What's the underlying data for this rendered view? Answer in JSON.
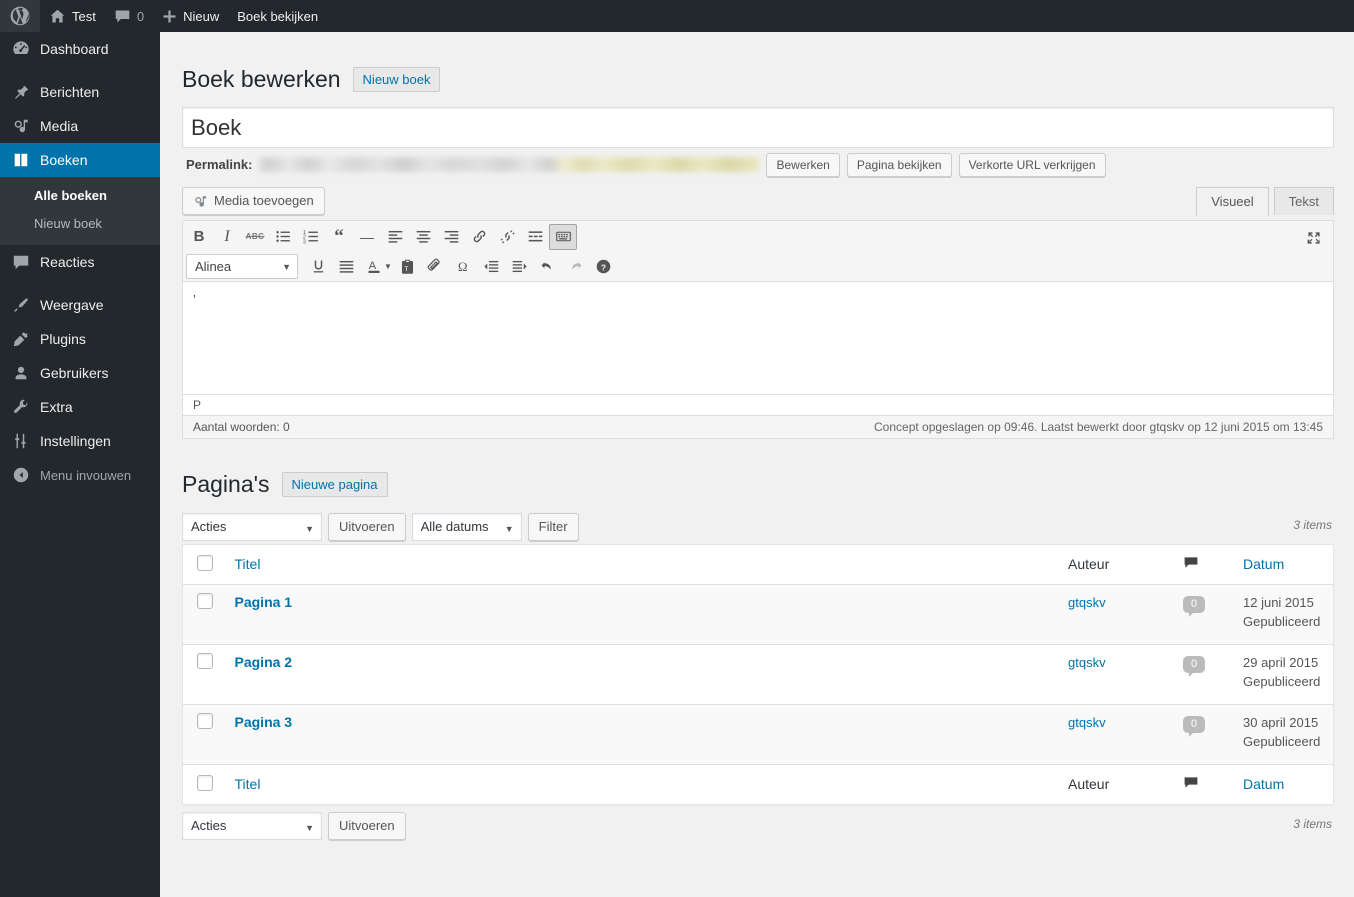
{
  "adminbar": {
    "wp_logo": "wordpress-logo-icon",
    "site_name": "Test",
    "comment_count": "0",
    "new_label": "Nieuw",
    "view_label": "Boek bekijken"
  },
  "sidebar": {
    "items": [
      {
        "label": "Dashboard",
        "icon": "dashboard-icon",
        "current": false
      },
      {
        "label": "Berichten",
        "icon": "pin-icon",
        "current": false
      },
      {
        "label": "Media",
        "icon": "media-icon",
        "current": false
      },
      {
        "label": "Boeken",
        "icon": "book-icon",
        "current": true
      },
      {
        "label": "Reacties",
        "icon": "comment-icon",
        "current": false
      },
      {
        "label": "Weergave",
        "icon": "appearance-brush-icon",
        "current": false
      },
      {
        "label": "Plugins",
        "icon": "plugin-plug-icon",
        "current": false
      },
      {
        "label": "Gebruikers",
        "icon": "user-icon",
        "current": false
      },
      {
        "label": "Extra",
        "icon": "tools-wrench-icon",
        "current": false
      },
      {
        "label": "Instellingen",
        "icon": "settings-sliders-icon",
        "current": false
      }
    ],
    "submenu": [
      {
        "label": "Alle boeken",
        "current": true
      },
      {
        "label": "Nieuw boek",
        "current": false
      }
    ],
    "collapse": {
      "label": "Menu invouwen",
      "icon": "collapse-arrow-icon"
    }
  },
  "editor_page": {
    "heading": "Boek bewerken",
    "add_new_label": "Nieuw boek",
    "title_value": "Boek",
    "permalink_label": "Permalink:",
    "permalink_buttons": [
      "Bewerken",
      "Pagina bekijken",
      "Verkorte URL verkrijgen"
    ],
    "media_button_label": "Media toevoegen",
    "tabs": [
      {
        "label": "Visueel",
        "active": true
      },
      {
        "label": "Tekst",
        "active": false
      }
    ],
    "toolbar_row1": [
      {
        "name": "bold-icon",
        "glyph": "B"
      },
      {
        "name": "italic-icon",
        "glyph": "I"
      },
      {
        "name": "strikethrough-icon",
        "glyph": "ABC"
      },
      {
        "name": "bullet-list-icon",
        "glyph": ""
      },
      {
        "name": "numbered-list-icon",
        "glyph": ""
      },
      {
        "name": "blockquote-icon",
        "glyph": "“"
      },
      {
        "name": "horizontal-rule-icon",
        "glyph": "—"
      },
      {
        "name": "align-left-icon",
        "glyph": ""
      },
      {
        "name": "align-center-icon",
        "glyph": ""
      },
      {
        "name": "align-right-icon",
        "glyph": ""
      },
      {
        "name": "insert-link-icon",
        "glyph": ""
      },
      {
        "name": "unlink-icon",
        "glyph": ""
      },
      {
        "name": "read-more-icon",
        "glyph": ""
      },
      {
        "name": "toggle-toolbar-icon",
        "glyph": ""
      }
    ],
    "format_select": "Alinea",
    "toolbar_row2": [
      {
        "name": "underline-icon"
      },
      {
        "name": "justify-icon"
      },
      {
        "name": "text-color-icon"
      },
      {
        "name": "paste-as-text-icon"
      },
      {
        "name": "clear-formatting-icon"
      },
      {
        "name": "special-character-icon"
      },
      {
        "name": "outdent-icon"
      },
      {
        "name": "indent-icon"
      },
      {
        "name": "undo-icon"
      },
      {
        "name": "redo-icon"
      },
      {
        "name": "keyboard-shortcuts-icon"
      }
    ],
    "content_text": "’",
    "path_indicator": "P",
    "word_count_label": "Aantal woorden: 0",
    "autosave_info": "Concept opgeslagen op 09:46. Laatst bewerkt door gtqskv op 12 juni 2015 om 13:45"
  },
  "pages_list": {
    "heading": "Pagina's",
    "add_new_label": "Nieuwe pagina",
    "bulk_action_top": "Acties",
    "apply_top_label": "Uitvoeren",
    "date_filter": "Alle datums",
    "filter_label": "Filter",
    "items_count_top": "3 items",
    "bulk_action_bottom": "Acties",
    "apply_bottom_label": "Uitvoeren",
    "items_count_bottom": "3 items",
    "columns": {
      "title": "Titel",
      "author": "Auteur",
      "comments": "comment-bubble-icon",
      "date": "Datum"
    },
    "rows": [
      {
        "title": "Pagina 1",
        "author": "gtqskv",
        "comments": "0",
        "date": "12 juni 2015",
        "status": "Gepubliceerd"
      },
      {
        "title": "Pagina 2",
        "author": "gtqskv",
        "comments": "0",
        "date": "29 april 2015",
        "status": "Gepubliceerd"
      },
      {
        "title": "Pagina 3",
        "author": "gtqskv",
        "comments": "0",
        "date": "30 april 2015",
        "status": "Gepubliceerd"
      }
    ]
  },
  "colors": {
    "admin_dark": "#23282d",
    "admin_submenu": "#32373c",
    "accent_blue": "#0073aa",
    "link_blue": "#0073aa",
    "page_bg": "#f1f1f1"
  }
}
